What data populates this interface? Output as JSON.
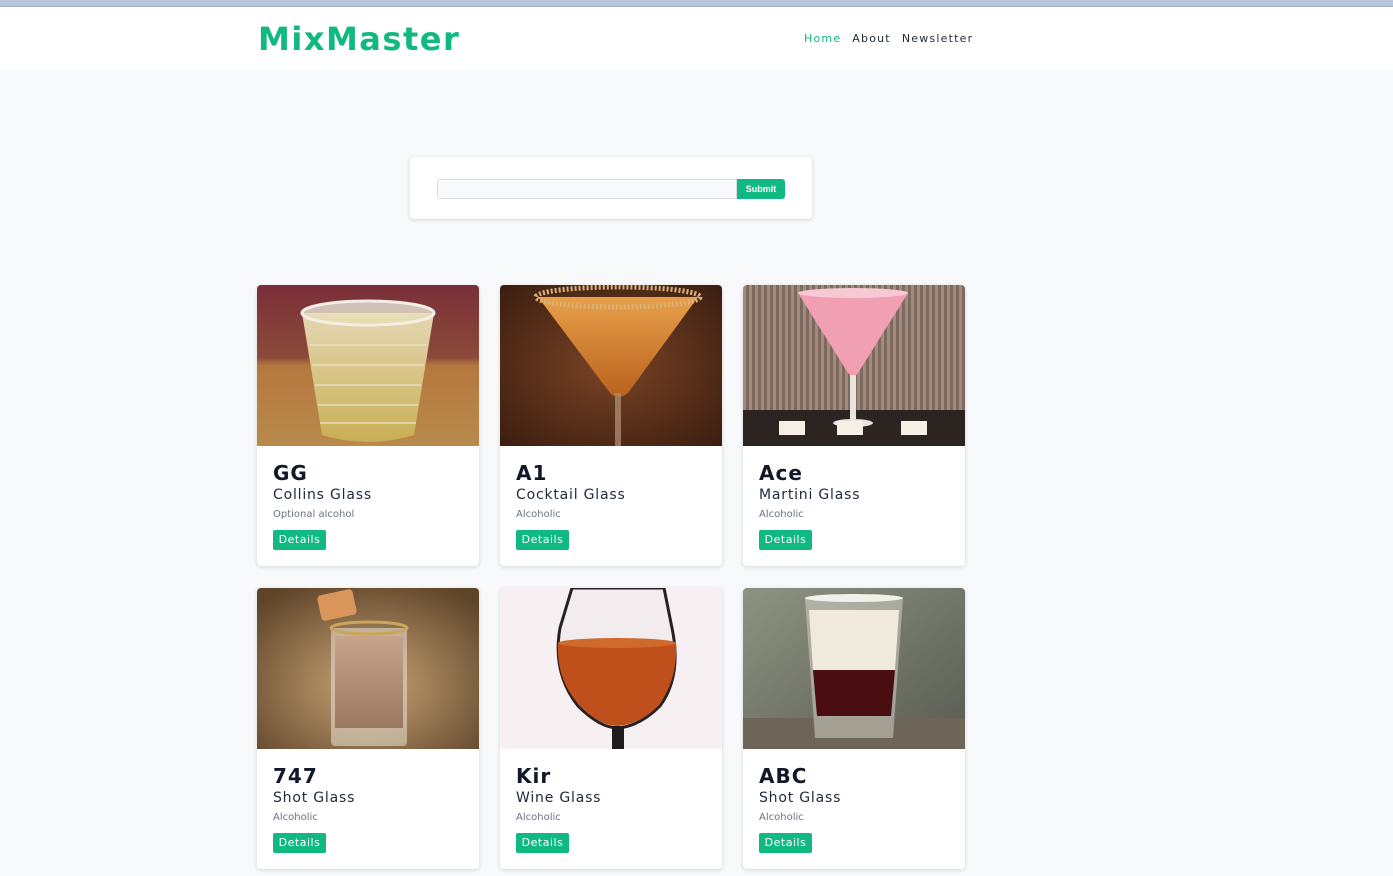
{
  "brand": {
    "name": "MixMaster",
    "accent": "#10b981"
  },
  "nav": {
    "items": [
      {
        "label": "Home",
        "active": true
      },
      {
        "label": "About",
        "active": false
      },
      {
        "label": "Newsletter",
        "active": false
      }
    ]
  },
  "search": {
    "value": "",
    "placeholder": "",
    "submit_label": "Submit"
  },
  "cocktails": [
    {
      "name": "GG",
      "glass": "Collins Glass",
      "type": "Optional alcohol",
      "button": "Details",
      "image": "cocktail-gg-image"
    },
    {
      "name": "A1",
      "glass": "Cocktail Glass",
      "type": "Alcoholic",
      "button": "Details",
      "image": "cocktail-a1-image"
    },
    {
      "name": "Ace",
      "glass": "Martini Glass",
      "type": "Alcoholic",
      "button": "Details",
      "image": "cocktail-ace-image"
    },
    {
      "name": "747",
      "glass": "Shot Glass",
      "type": "Alcoholic",
      "button": "Details",
      "image": "cocktail-747-image"
    },
    {
      "name": "Kir",
      "glass": "Wine Glass",
      "type": "Alcoholic",
      "button": "Details",
      "image": "cocktail-kir-image"
    },
    {
      "name": "ABC",
      "glass": "Shot Glass",
      "type": "Alcoholic",
      "button": "Details",
      "image": "cocktail-abc-image"
    }
  ]
}
